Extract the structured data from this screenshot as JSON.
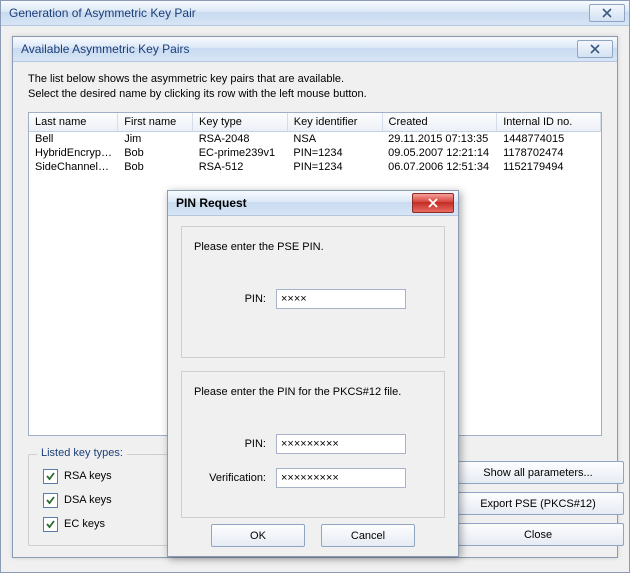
{
  "outer": {
    "title": "Generation of Asymmetric Key Pair"
  },
  "middle": {
    "title": "Available Asymmetric Key Pairs",
    "intro_line1": "The list below shows the asymmetric key pairs that are available.",
    "intro_line2": "Select the desired name by clicking its row with the left mouse button.",
    "columns": [
      "Last name",
      "First name",
      "Key type",
      "Key identifier",
      "Created",
      "Internal ID no."
    ],
    "rows": [
      [
        "Bell",
        "Jim",
        "RSA-2048",
        "NSA",
        "29.11.2015 07:13:35",
        "1448774015"
      ],
      [
        "HybridEncrypti...",
        "Bob",
        "EC-prime239v1",
        "PIN=1234",
        "09.05.2007 12:21:14",
        "1178702474"
      ],
      [
        "SideChannelAt...",
        "Bob",
        "RSA-512",
        "PIN=1234",
        "06.07.2006 12:51:34",
        "1152179494"
      ]
    ],
    "listed_legend": "Listed key types:",
    "chk_rsa": "RSA keys",
    "chk_dsa": "DSA keys",
    "chk_ec": "EC keys",
    "btn_showall": "Show all parameters...",
    "btn_export": "Export PSE (PKCS#12)",
    "btn_close": "Close"
  },
  "dialog": {
    "title": "PIN Request",
    "pse_prompt": "Please enter the PSE PIN.",
    "pin_label": "PIN:",
    "pse_pin_value": "××××",
    "pkcs_prompt": "Please enter the PIN for the PKCS#12 file.",
    "pkcs_pin_value": "×××××××××",
    "ver_label": "Verification:",
    "pkcs_ver_value": "×××××××××",
    "ok": "OK",
    "cancel": "Cancel"
  }
}
